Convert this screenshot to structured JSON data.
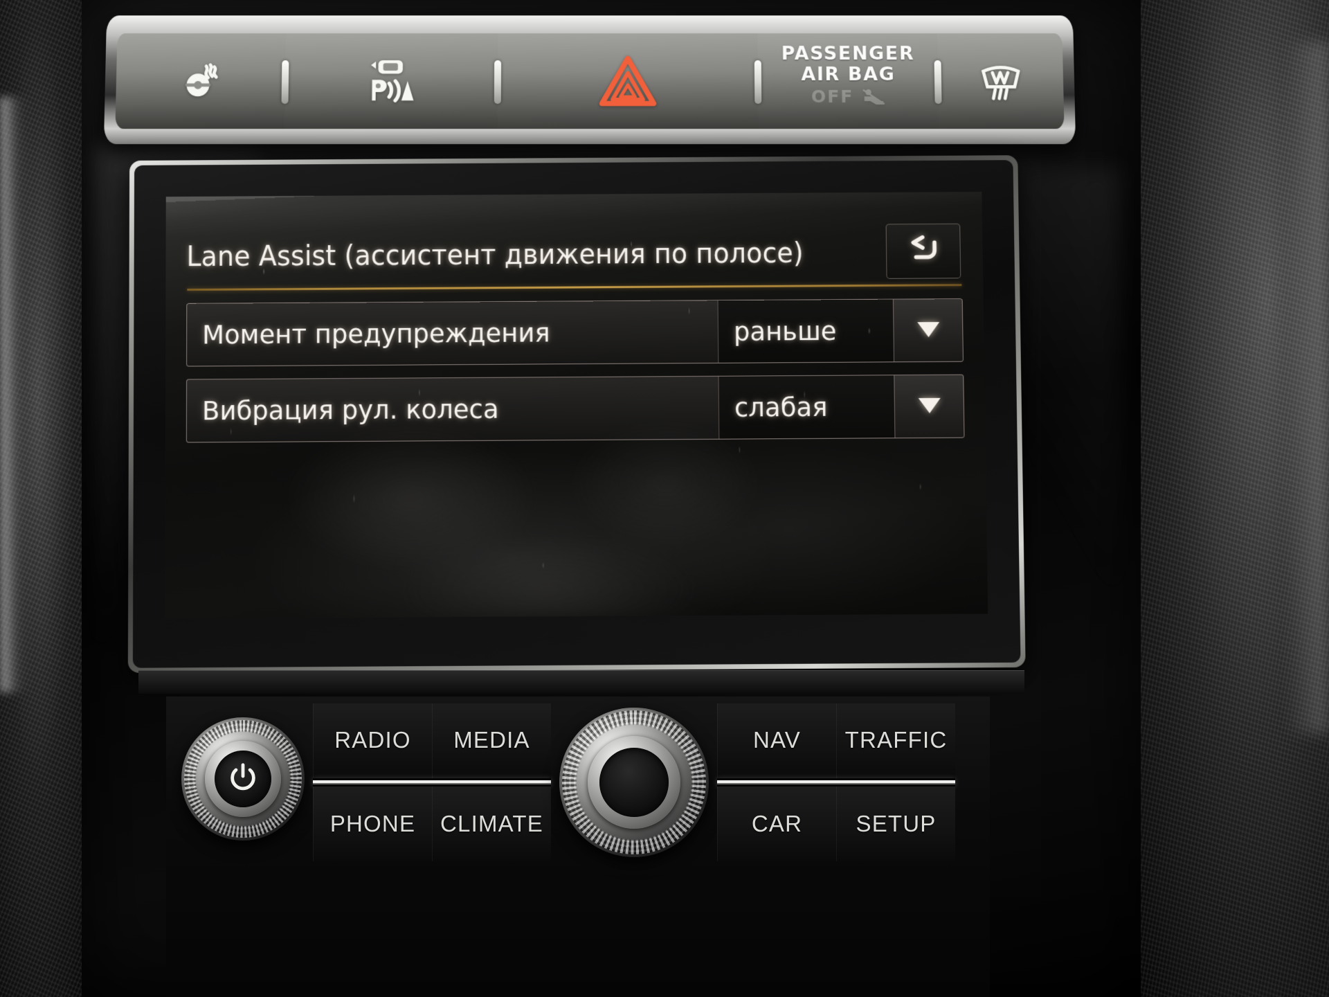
{
  "device": {
    "name": "volkswagen-rns-infotainment",
    "colors": {
      "screen_bg": "#0e0e0d",
      "text": "#f7f3ef",
      "divider_amber": "#b08a3c",
      "row_border": "#e2cec8",
      "hazard_red": "#f1603a",
      "button_text": "#ddddda"
    }
  },
  "top_buttons": [
    {
      "name": "heated-seat-button",
      "icon": "heated-seat-icon",
      "label": ""
    },
    {
      "name": "park-assist-button",
      "icon": "park-assist-icon",
      "label": ""
    },
    {
      "name": "hazard-lights-button",
      "icon": "hazard-triangle-icon",
      "label": ""
    },
    {
      "name": "passenger-airbag-indicator",
      "icon": "airbag-off-icon",
      "label_line1": "PASSENGER",
      "label_line2": "AIR BAG",
      "status": "OFF"
    },
    {
      "name": "windshield-defrost-button",
      "icon": "defrost-icon",
      "label": ""
    }
  ],
  "screen": {
    "title": "Lane Assist (ассистент движения по полосе)",
    "back_button": {
      "icon": "back-arrow-icon",
      "label": ""
    },
    "rows": [
      {
        "label": "Момент предупреждения",
        "value": "раньше",
        "dropdown_icon": "chevron-down-icon"
      },
      {
        "label": "Вибрация рул. колеса",
        "value": "слабая",
        "dropdown_icon": "chevron-down-icon"
      }
    ]
  },
  "bottom_panel": {
    "power_knob": {
      "icon": "power-icon",
      "label": ""
    },
    "tune_knob": {
      "icon": "rotary-knob",
      "label": ""
    },
    "left_buttons": [
      "RADIO",
      "MEDIA",
      "PHONE",
      "CLIMATE"
    ],
    "right_buttons": [
      "NAV",
      "TRAFFIC",
      "CAR",
      "SETUP"
    ]
  }
}
